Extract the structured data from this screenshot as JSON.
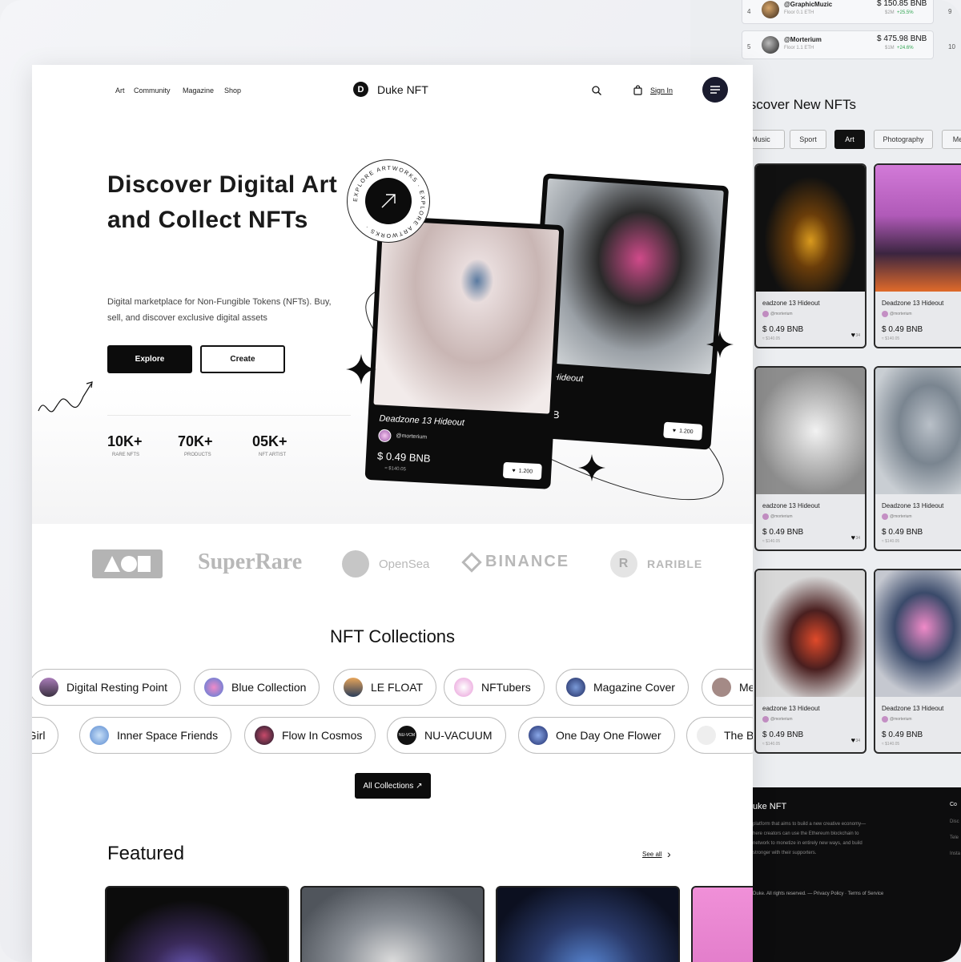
{
  "back_page": {
    "ranking_rows": [
      {
        "rank": "4",
        "right_rank": "9",
        "name": "@GraphicMuzic",
        "sub": "Floor 0.1 ETH",
        "price": "150.85 BNB",
        "meta_a": "$2M",
        "meta_b": "+25.5%"
      },
      {
        "rank": "5",
        "right_rank": "10",
        "name": "@Morterium",
        "sub": "Floor 1.1 ETH",
        "price": "475.98 BNB",
        "meta_a": "$1M",
        "meta_b": "+24.6%"
      }
    ],
    "title": "iscover New NFTs",
    "tabs": [
      {
        "label": "Music",
        "active": false
      },
      {
        "label": "Sport",
        "active": false
      },
      {
        "label": "Art",
        "active": true
      },
      {
        "label": "Photography",
        "active": false
      },
      {
        "label": "Me",
        "active": false
      }
    ],
    "cards": [
      {
        "title": "eadzone 13 Hideout",
        "owner": "@morterium",
        "price": "0.49 BNB",
        "usd": "≈ $140.05",
        "likes": "34"
      },
      {
        "title": "Deadzone 13 Hideout",
        "owner": "@morterium",
        "price": "0.49 BNB",
        "usd": "≈ $140.05",
        "likes": ""
      },
      {
        "title": "eadzone 13 Hideout",
        "owner": "@morterium",
        "price": "0.49 BNB",
        "usd": "≈ $140.05",
        "likes": "34"
      },
      {
        "title": "Deadzone 13 Hideout",
        "owner": "@morterium",
        "price": "0.49 BNB",
        "usd": "≈ $140.05",
        "likes": ""
      },
      {
        "title": "eadzone 13 Hideout",
        "owner": "@morterium",
        "price": "0.49 BNB",
        "usd": "≈ $140.05",
        "likes": "34"
      },
      {
        "title": "Deadzone 13 Hideout",
        "owner": "@morterium",
        "price": "0.49 BNB",
        "usd": "≈ $140.05",
        "likes": ""
      }
    ],
    "footer": {
      "brand": "uke NFT",
      "text": "platform that aims to build a new creative economy— here creators can use the Ethereum blockchain to network to monetize in entirely new ways, and build stronger with their supporters.",
      "copyright": "Duke. All rights reserved.  —  Privacy Policy · Terms of Service",
      "col_title": "Co",
      "col_items": [
        "Disc",
        "Tele",
        "Insta"
      ]
    }
  },
  "nav": {
    "links": [
      "Art",
      "Community",
      "Magazine",
      "Shop"
    ],
    "logo_letter": "D",
    "brand": "Duke NFT",
    "signin": "Sign In"
  },
  "hero": {
    "title": "Discover Digital Art and Collect NFTs",
    "description": "Digital marketplace for Non-Fungible Tokens (NFTs). Buy, sell, and discover exclusive digital assets",
    "explore_label": "Explore",
    "create_label": "Create",
    "badge_text": "EXPLORE ARTWORKS · EXPLORE ARTWORKS ·",
    "stats": [
      {
        "value": "10K+",
        "label": "RARE NFTS"
      },
      {
        "value": "70K+",
        "label": "PRODUCTS"
      },
      {
        "value": "05K+",
        "label": "NFT ARTIST"
      }
    ],
    "card_front": {
      "title": "Deadzone 13 Hideout",
      "owner": "@morterium",
      "price": "0.49 BNB",
      "usd": "≈ $140.05",
      "likes": "1.200"
    },
    "card_back": {
      "title": "13 Hideout",
      "owner": "rium",
      "price": "BNB",
      "likes": "1.200"
    }
  },
  "partners": [
    "AOB",
    "SuperRare",
    "OpenSea",
    "BINANCE",
    "RARIBLE"
  ],
  "collections": {
    "title": "NFT Collections",
    "row1": [
      {
        "label": "Digital Resting Point",
        "color": "#6d5a7a"
      },
      {
        "label": "Blue Collection",
        "color": "#4d7ed8"
      },
      {
        "label": "LE FLOAT",
        "color": "#c27b3a"
      },
      {
        "label": "NFTubers",
        "color": "#e89ad8"
      },
      {
        "label": "Magazine Cover",
        "color": "#2f3f8a"
      },
      {
        "label": "Me",
        "color": "#a48a86"
      }
    ],
    "row2": [
      {
        "label": "g Girl",
        "color": ""
      },
      {
        "label": "Inner Space Friends",
        "color": "#6aa0d8"
      },
      {
        "label": "Flow In Cosmos",
        "color": "#8a2a3a"
      },
      {
        "label": "NU-VACUUM",
        "color": "#111111",
        "dot_text": "NU-VCM"
      },
      {
        "label": "One Day One Flower",
        "color": "#2a3c7a"
      },
      {
        "label": "The B",
        "color": "#eeeeee"
      }
    ],
    "all_label": "All Collections ↗"
  },
  "featured": {
    "title": "Featured",
    "see_all": "See all"
  }
}
